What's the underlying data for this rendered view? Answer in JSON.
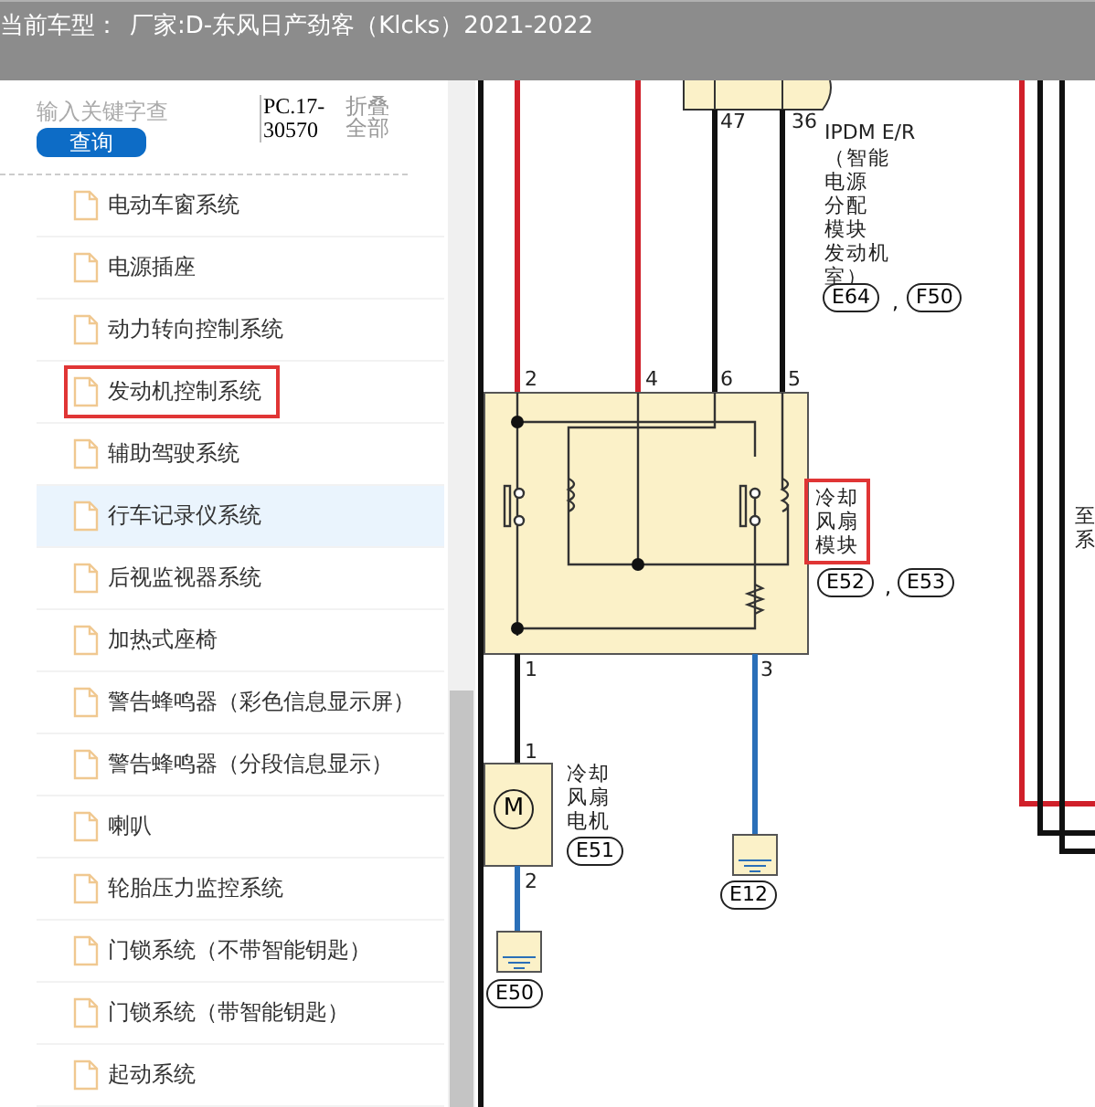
{
  "title_bar": {
    "label": "当前车型：",
    "vehicle": "厂家:D-东风日产劲客（Klcks）2021-2022"
  },
  "sidebar": {
    "search": {
      "placeholder": "输入关键字查"
    },
    "search_button": "查询",
    "code": "PC.17-30570",
    "collapse_all": "折叠全部",
    "items": [
      {
        "label": "电动车窗系统",
        "selected": false,
        "marked": false
      },
      {
        "label": "电源插座",
        "selected": false,
        "marked": false
      },
      {
        "label": "动力转向控制系统",
        "selected": false,
        "marked": false
      },
      {
        "label": "发动机控制系统",
        "selected": false,
        "marked": true
      },
      {
        "label": "辅助驾驶系统",
        "selected": false,
        "marked": false
      },
      {
        "label": "行车记录仪系统",
        "selected": true,
        "marked": false
      },
      {
        "label": "后视监视器系统",
        "selected": false,
        "marked": false
      },
      {
        "label": "加热式座椅",
        "selected": false,
        "marked": false
      },
      {
        "label": "警告蜂鸣器（彩色信息显示屏）",
        "selected": false,
        "marked": false
      },
      {
        "label": "警告蜂鸣器（分段信息显示）",
        "selected": false,
        "marked": false
      },
      {
        "label": "喇叭",
        "selected": false,
        "marked": false
      },
      {
        "label": "轮胎压力监控系统",
        "selected": false,
        "marked": false
      },
      {
        "label": "门锁系统（不带智能钥匙）",
        "selected": false,
        "marked": false
      },
      {
        "label": "门锁系统（带智能钥匙）",
        "selected": false,
        "marked": false
      },
      {
        "label": "起动系统",
        "selected": false,
        "marked": false
      }
    ]
  },
  "diagram": {
    "ipdm_pins": [
      "47",
      "36"
    ],
    "ipdm_name": "IPDM E/R",
    "ipdm_desc": [
      "（智能",
      "电源",
      "分配",
      "模块",
      "发动机",
      "室）"
    ],
    "ipdm_connectors": [
      "E64",
      "F50"
    ],
    "separator": ",",
    "module_top_pins": [
      "2",
      "4",
      "6",
      "5"
    ],
    "module_name": [
      "冷却",
      "风扇",
      "模块"
    ],
    "module_connectors": [
      "E52",
      "E53"
    ],
    "module_bottom_pins": [
      "1",
      "3"
    ],
    "motor_pins": [
      "1",
      "2"
    ],
    "motor_symbol": "M",
    "motor_name": [
      "冷却",
      "风扇",
      "电机"
    ],
    "motor_connector": "E51",
    "ground_connectors": [
      "E50",
      "E12"
    ],
    "edge_text": [
      "至",
      "系"
    ]
  }
}
